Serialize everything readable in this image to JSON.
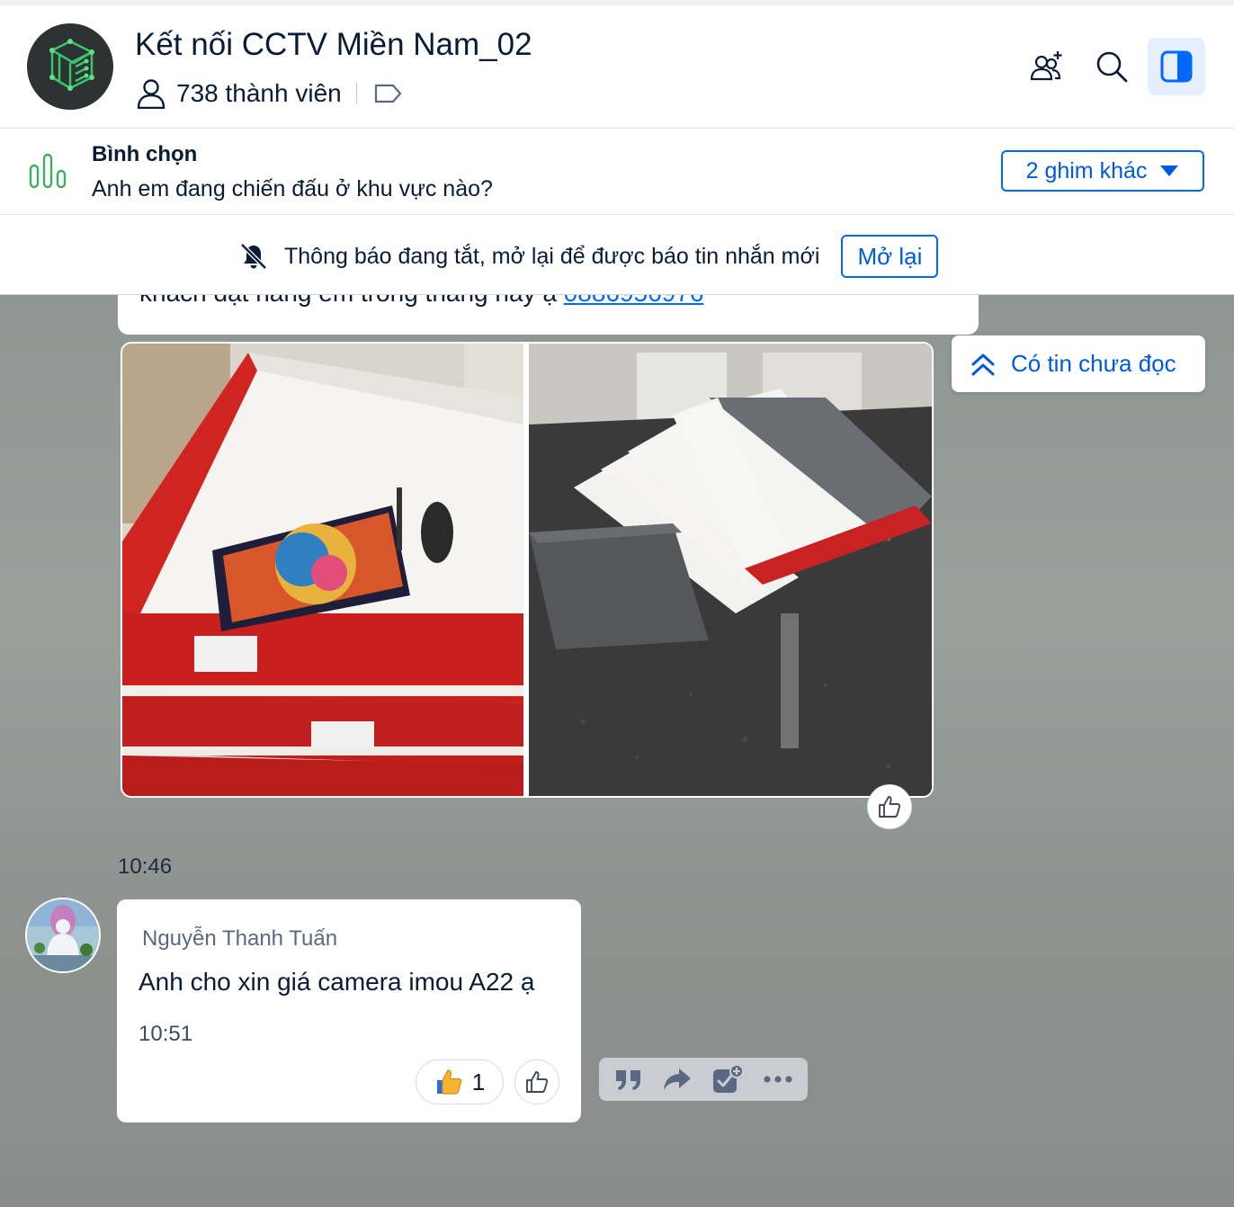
{
  "header": {
    "group_name": "Kết nối CCTV Miền Nam_02",
    "member_count": "738 thành viên",
    "icons": [
      "add-member-icon",
      "search-icon",
      "sidebar-toggle-icon"
    ],
    "accent_color": "#0068ff"
  },
  "pinned": {
    "title": "Bình chọn",
    "text": "Anh em đang chiến đấu ở khu vực nào?",
    "more_label": "2 ghim khác",
    "icon": "poll-icon",
    "icon_color": "#3ab05b"
  },
  "notification": {
    "text": "Thông báo đang tắt, mở lại để được báo tin nhắn mới",
    "button_label": "Mở lại",
    "icon": "bell-off-icon"
  },
  "chat": {
    "previous_message": {
      "text": "khách đặt hàng em trong tháng này ạ ",
      "link": "0886956976"
    },
    "unread_pill": "Có tin chưa đọc",
    "time_separator": "10:46",
    "message": {
      "sender": "Nguyễn Thanh Tuấn",
      "text": "Anh cho xin giá camera imou A22 ạ",
      "time": "10:51",
      "reaction_count": "1"
    },
    "action_icons": [
      "quote-icon",
      "forward-icon",
      "add-task-icon",
      "more-icon"
    ]
  }
}
